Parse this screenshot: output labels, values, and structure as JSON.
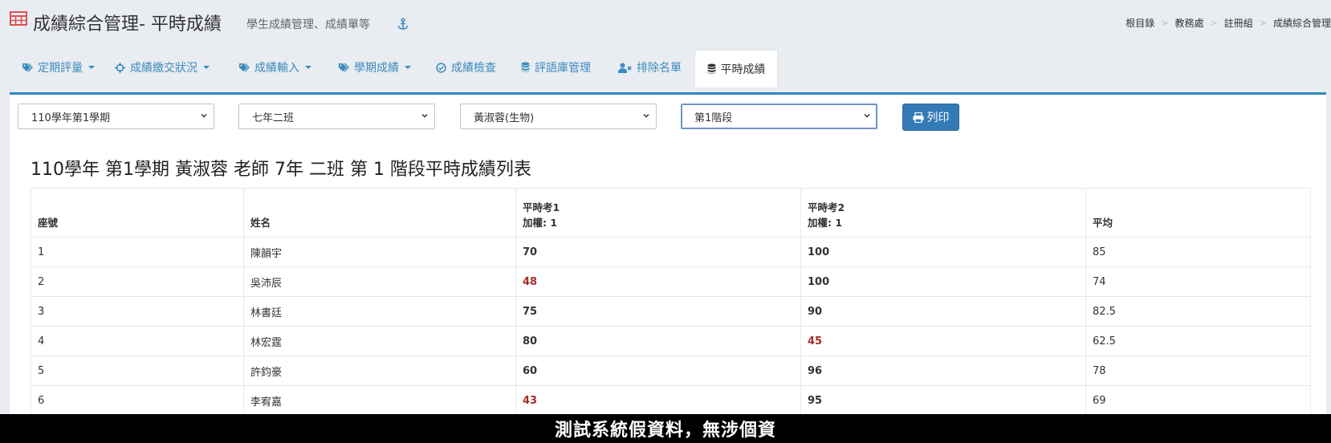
{
  "header": {
    "title": "成績綜合管理- 平時成績",
    "subtitle": "學生成績管理、成績單等",
    "breadcrumb": [
      "根目錄",
      "教務處",
      "註冊組",
      "成績綜合管理"
    ]
  },
  "tabs": [
    {
      "label": "定期評量",
      "icon": "tags-icon",
      "dropdown": true,
      "active": false
    },
    {
      "label": "成績繳交狀況",
      "icon": "crosshairs-icon",
      "dropdown": true,
      "active": false
    },
    {
      "label": "成績輸入",
      "icon": "tags-icon",
      "dropdown": true,
      "active": false
    },
    {
      "label": "學期成績",
      "icon": "tags-icon",
      "dropdown": true,
      "active": false
    },
    {
      "label": "成績檢查",
      "icon": "check-circle-icon",
      "dropdown": false,
      "active": false
    },
    {
      "label": "評語庫管理",
      "icon": "database-icon",
      "dropdown": false,
      "active": false
    },
    {
      "label": "排除名單",
      "icon": "user-times-icon",
      "dropdown": false,
      "active": false
    },
    {
      "label": "平時成績",
      "icon": "database-icon",
      "dropdown": false,
      "active": true
    }
  ],
  "filters": {
    "semester": "110學年第1學期",
    "class": "七年二班",
    "teacher": "黃淑蓉(生物)",
    "stage": "第1階段",
    "print_label": "列印"
  },
  "list_title": "110學年 第1學期 黃淑蓉 老師 7年 二班 第 1 階段平時成績列表",
  "table": {
    "headers": {
      "seat": "座號",
      "name": "姓名",
      "quiz1": "平時考1",
      "quiz1_weight": "加權: 1",
      "quiz2": "平時考2",
      "quiz2_weight": "加權: 1",
      "avg": "平均"
    },
    "rows": [
      {
        "seat": "1",
        "name": "陳韻宇",
        "quiz1": "70",
        "quiz2": "100",
        "avg": "85"
      },
      {
        "seat": "2",
        "name": "吳沛辰",
        "quiz1": "48",
        "quiz2": "100",
        "avg": "74"
      },
      {
        "seat": "3",
        "name": "林書廷",
        "quiz1": "75",
        "quiz2": "90",
        "avg": "82.5"
      },
      {
        "seat": "4",
        "name": "林宏霆",
        "quiz1": "80",
        "quiz2": "45",
        "avg": "62.5"
      },
      {
        "seat": "5",
        "name": "許鈞豪",
        "quiz1": "60",
        "quiz2": "96",
        "avg": "78"
      },
      {
        "seat": "6",
        "name": "李宥嘉",
        "quiz1": "43",
        "quiz2": "95",
        "avg": "69"
      }
    ]
  },
  "notice": "測試系統假資料，無涉個資",
  "colors": {
    "accent": "#337ab7",
    "tab_link": "#3a8bbf",
    "fail": "#a32d2d",
    "title_icon": "#d9534f"
  }
}
